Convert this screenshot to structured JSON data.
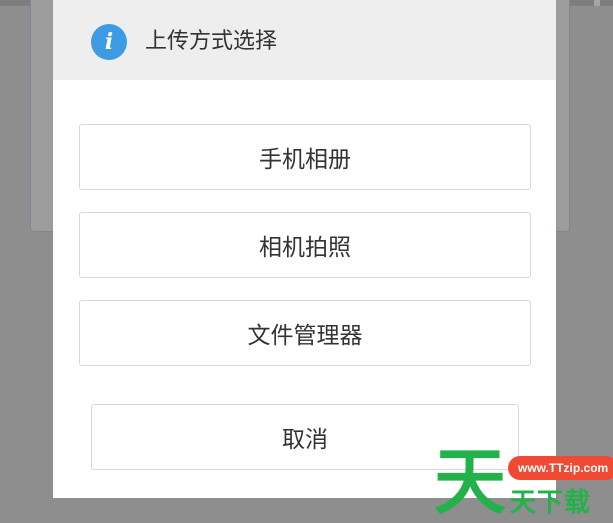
{
  "dialog": {
    "title": "上传方式选择",
    "options": {
      "album": "手机相册",
      "camera": "相机拍照",
      "files": "文件管理器"
    },
    "cancel": "取消"
  },
  "watermark": {
    "logo_char": "天",
    "url": "www.TTzip.com",
    "text": "天下载"
  },
  "colors": {
    "info_icon": "#3d9be3",
    "header_bg": "#eeeeee",
    "overlay": "#8e8e8e",
    "watermark_green": "#23b14a",
    "watermark_red": "#f04a34"
  }
}
